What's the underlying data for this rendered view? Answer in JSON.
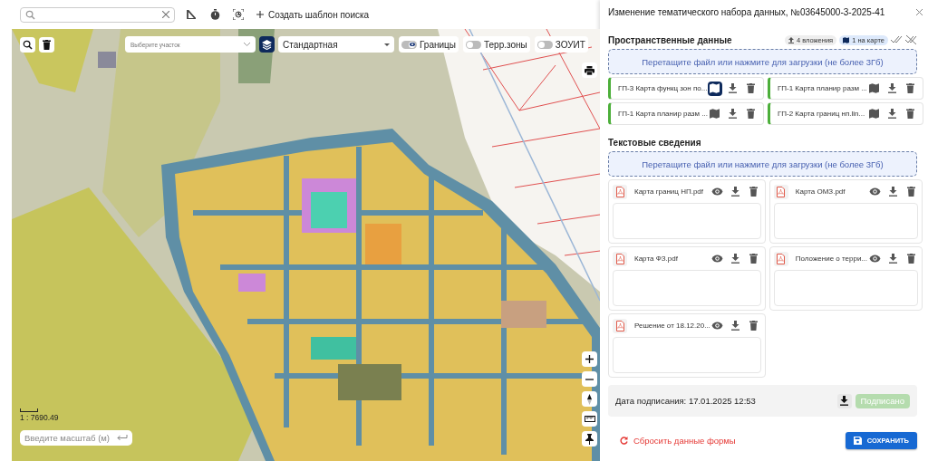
{
  "toolbar": {
    "create_template": "Создать шаблон поиска"
  },
  "map": {
    "parcel_select": {
      "placeholder": "Выберите участок"
    },
    "basemap": "Стандартная",
    "toggles": [
      {
        "label": "Границы",
        "on": true
      },
      {
        "label": "Терр.зоны",
        "on": false
      },
      {
        "label": "ЗОУИТ",
        "on": false
      }
    ],
    "scale": "1 : 7690.49",
    "scale_input": {
      "placeholder": "Введите масштаб (м)"
    }
  },
  "panel": {
    "title": "Изменение тематического набора данных, №03645000-3-2025-41",
    "spatial": {
      "heading": "Пространственные данные",
      "attachments_badge": "4 вложения",
      "on_map_badge": "1 на карте",
      "dropzone": "Перетащите файл или нажмите для загрузки (не более 3Гб)",
      "files": [
        {
          "name": "ГП-3 Карта функц зон по...",
          "on_map": true
        },
        {
          "name": "ГП-1 Карта планир разм ...",
          "on_map": false
        },
        {
          "name": "ГП-1 Карта планир разм ...",
          "on_map": false
        },
        {
          "name": "ГП-2 Карта границ нп.lin...",
          "on_map": false
        }
      ]
    },
    "text": {
      "heading": "Текстовые сведения",
      "dropzone": "Перетащите файл или нажмите для загрузки (не более 3Гб)",
      "files": [
        {
          "name": "Карта границ НП.pdf"
        },
        {
          "name": "Карта ОМЗ.pdf"
        },
        {
          "name": "Карта ФЗ.pdf"
        },
        {
          "name": "Положение о терри..."
        },
        {
          "name": "Решение от 18.12.20..."
        }
      ]
    },
    "signature": {
      "text": "Дата подписания: 17.01.2025 12:53",
      "status": "Подписано",
      "disabled": true
    },
    "reset": "Сбросить данные формы",
    "save": "СОХРАНИТЬ"
  }
}
